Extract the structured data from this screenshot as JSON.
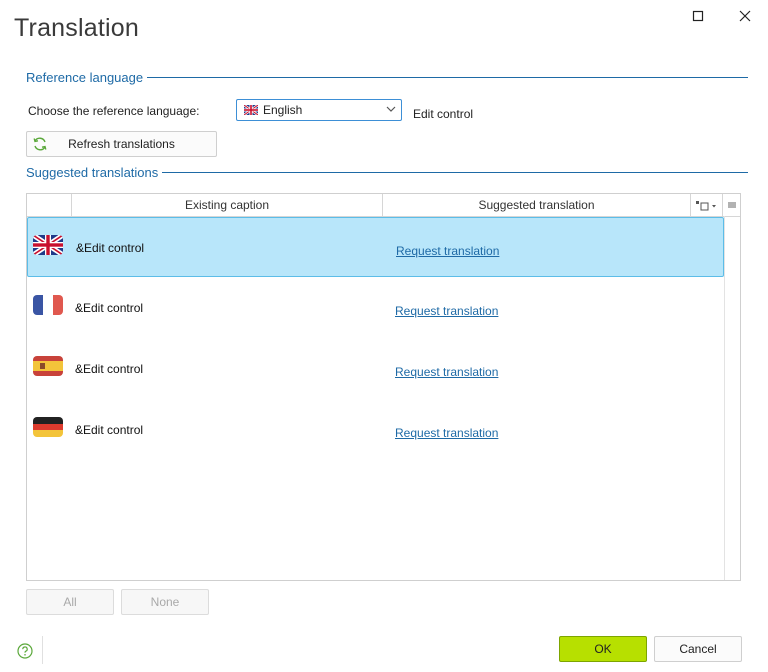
{
  "window": {
    "title": "Translation",
    "maximize_icon": "maximize-icon",
    "close_icon": "close-icon"
  },
  "reference": {
    "section_label": "Reference language",
    "choose_label": "Choose the reference language:",
    "selected_language": "English",
    "selected_flag": "uk-flag-icon",
    "control_caption": "Edit control",
    "refresh_label": "Refresh translations"
  },
  "suggested": {
    "section_label": "Suggested translations",
    "columns": [
      "Existing caption",
      "Suggested translation"
    ],
    "rows": [
      {
        "flag": "uk-flag-icon",
        "caption": "&Edit control",
        "action": "Request translation",
        "selected": true
      },
      {
        "flag": "france-flag-icon",
        "caption": "&Edit control",
        "action": "Request translation",
        "selected": false
      },
      {
        "flag": "spain-flag-icon",
        "caption": "&Edit control",
        "action": "Request translation",
        "selected": false
      },
      {
        "flag": "germany-flag-icon",
        "caption": "&Edit control",
        "action": "Request translation",
        "selected": false
      }
    ],
    "all_label": "All",
    "none_label": "None"
  },
  "footer": {
    "ok_label": "OK",
    "cancel_label": "Cancel",
    "help_icon": "help-icon"
  },
  "colors": {
    "accent": "#1e6aa6",
    "selection_bg": "#b8e6fa",
    "ok_bg": "#b7e000"
  }
}
